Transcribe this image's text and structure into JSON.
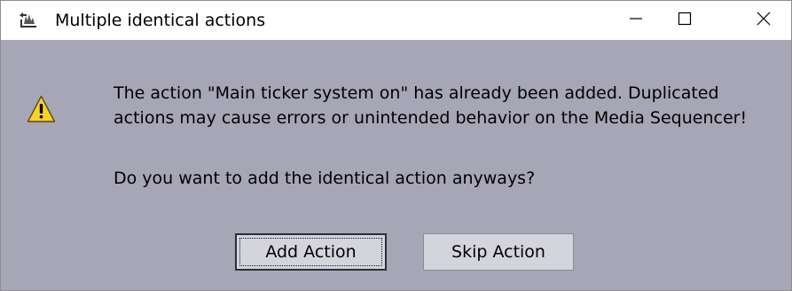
{
  "window": {
    "title": "Multiple identical actions",
    "title_icon": "app-icon",
    "controls": {
      "minimize": "minimize-icon",
      "maximize": "maximize-icon",
      "close": "close-icon"
    }
  },
  "dialog": {
    "icon": "warning-icon",
    "message_line1": "The action \"Main ticker system on\" has already been added. Duplicated",
    "message_line2": "actions may cause errors or unintended behavior on the Media Sequencer!",
    "question": "Do you want to add the identical action anyways?",
    "buttons": {
      "add_label": "Add Action",
      "skip_label": "Skip Action"
    }
  },
  "colors": {
    "dialog_background": "#a7a6b6",
    "titlebar_background": "#ffffff",
    "button_background": "#d4d4dc",
    "warning_fill": "#f7d229"
  }
}
